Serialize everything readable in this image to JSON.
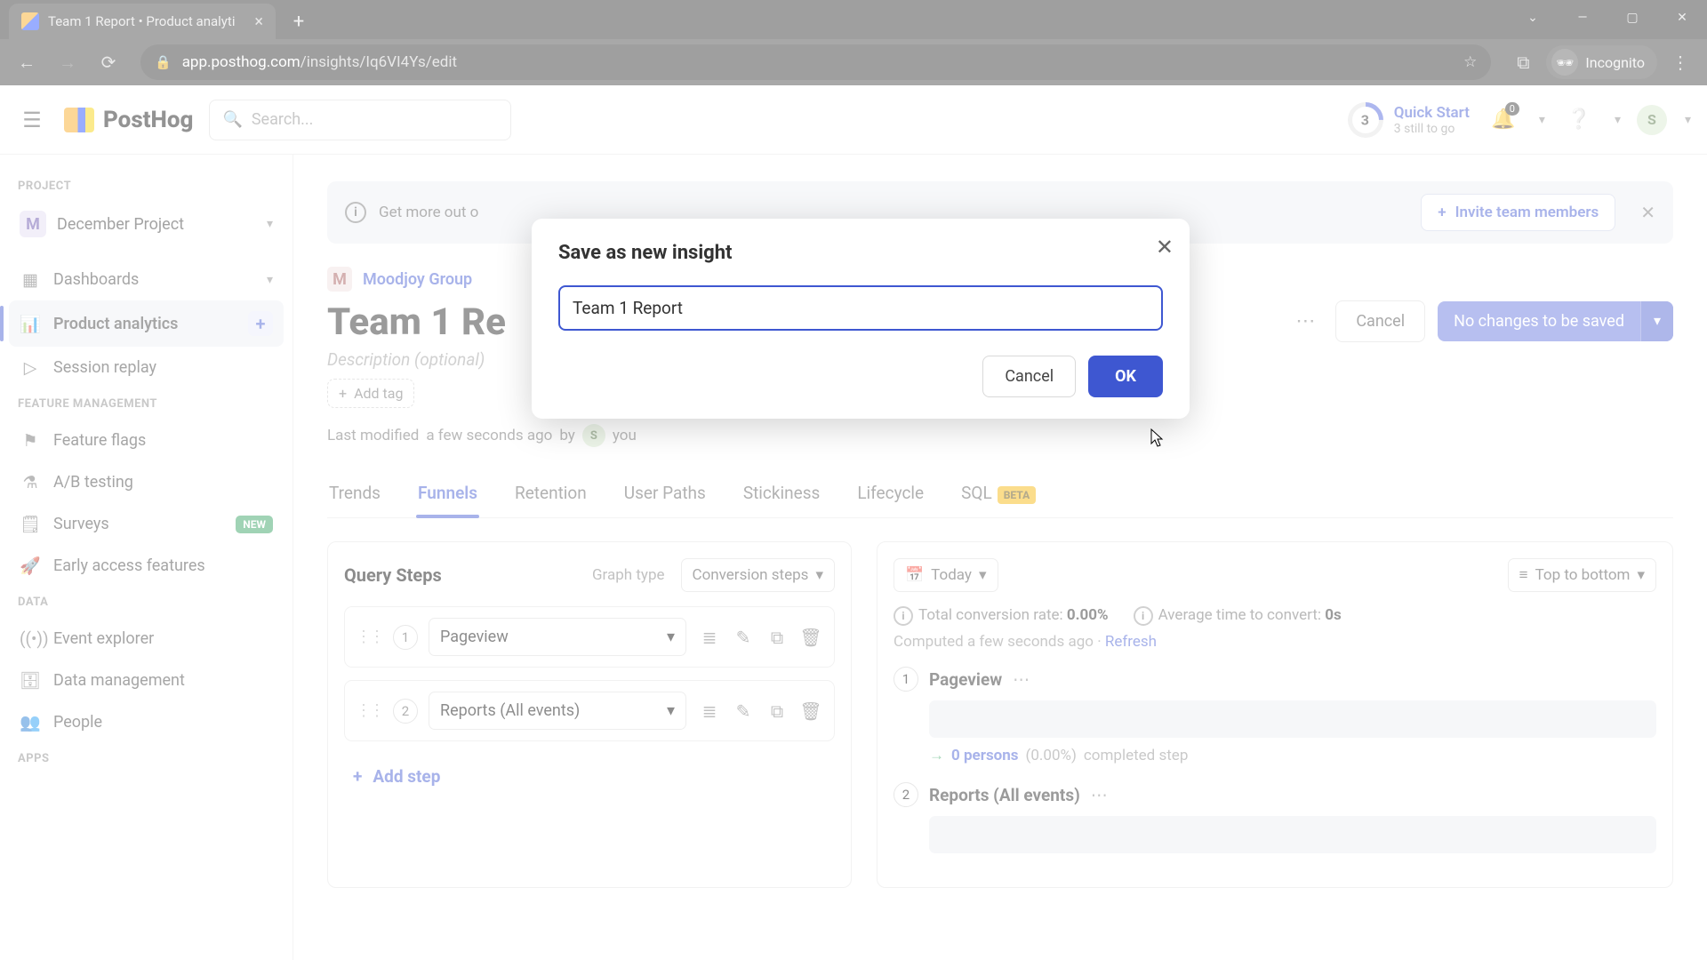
{
  "browser": {
    "tab_title": "Team 1 Report • Product analyti",
    "url_host": "app.posthog.com",
    "url_path": "/insights/Iq6VI4Ys/edit",
    "incognito_label": "Incognito"
  },
  "header": {
    "logo": "PostHog",
    "search_placeholder": "Search...",
    "quickstart": {
      "number": "3",
      "title": "Quick Start",
      "subtitle": "3 still to go"
    },
    "notif_badge": "0",
    "avatar_initial": "S"
  },
  "sidebar": {
    "labels": {
      "project": "PROJECT",
      "feature": "FEATURE MANAGEMENT",
      "data": "DATA",
      "apps": "APPS"
    },
    "project": {
      "initial": "M",
      "name": "December Project"
    },
    "nav": {
      "dashboards": "Dashboards",
      "analytics": "Product analytics",
      "session": "Session replay",
      "flags": "Feature flags",
      "ab": "A/B testing",
      "surveys": "Surveys",
      "surveys_badge": "NEW",
      "early": "Early access features",
      "event": "Event explorer",
      "datamgmt": "Data management",
      "people": "People"
    }
  },
  "banner": {
    "text": "Get more out o",
    "invite": "Invite team members"
  },
  "breadcrumb": {
    "initial": "M",
    "link": "Moodjoy Group"
  },
  "page": {
    "title": "Team 1 Re",
    "description_placeholder": "Description (optional)",
    "addtag": "Add tag",
    "cancel": "Cancel",
    "save_label": "No changes to be saved",
    "lastmod_prefix": "Last modified",
    "lastmod_time": "a few seconds ago",
    "lastmod_by": "by",
    "lastmod_av": "S",
    "lastmod_you": "you"
  },
  "tabs": [
    "Trends",
    "Funnels",
    "Retention",
    "User Paths",
    "Stickiness",
    "Lifecycle",
    "SQL"
  ],
  "tab_beta": "BETA",
  "query_panel": {
    "title": "Query Steps",
    "graphtype_lbl": "Graph type",
    "graphtype_val": "Conversion steps",
    "steps": [
      {
        "n": "1",
        "name": "Pageview"
      },
      {
        "n": "2",
        "name": "Reports (All events)"
      }
    ],
    "addstep": "Add step"
  },
  "results_panel": {
    "date": "Today",
    "layout": "Top to bottom",
    "conv_label": "Total conversion rate:",
    "conv_val": "0.00%",
    "avg_label": "Average time to convert:",
    "avg_val": "0s",
    "computed": "Computed a few seconds ago",
    "refresh": "Refresh",
    "fsteps": [
      {
        "n": "1",
        "name": "Pageview",
        "persons": "0 persons",
        "pct": "(0.00%)",
        "tail": "completed step"
      },
      {
        "n": "2",
        "name": "Reports (All events)"
      }
    ]
  },
  "modal": {
    "title": "Save as new insight",
    "input_value": "Team 1 Report",
    "cancel": "Cancel",
    "ok": "OK"
  }
}
